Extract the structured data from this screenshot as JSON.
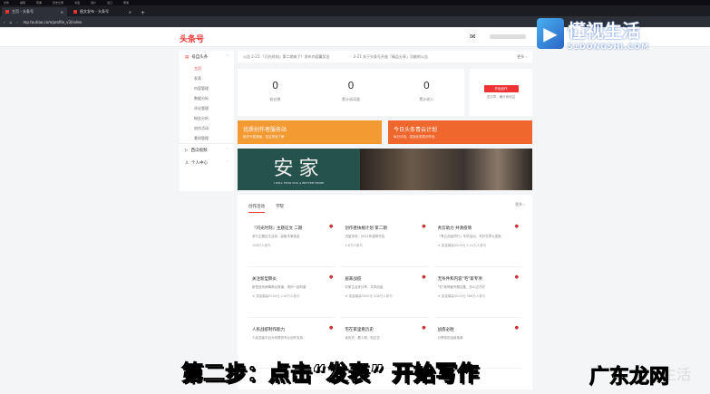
{
  "browser": {
    "menu": [
      "文件",
      "编辑",
      "查看",
      "历史记录",
      "书签",
      "用户",
      "窗口",
      "帮助"
    ],
    "tabs": [
      {
        "label": "主页 - 头条号"
      },
      {
        "label": "图文发布 - 头条号"
      }
    ],
    "url": "mp.toutiao.com/profile_v3/index"
  },
  "header": {
    "brand": "头条号",
    "mail_icon": "✉"
  },
  "sidebar": {
    "groups": [
      {
        "label": "号自头条",
        "items": [
          "主页",
          "发表",
          "内容管理",
          "数据分析",
          "评论管理",
          "粉丝分析",
          "创作活动",
          "素材管理"
        ]
      },
      {
        "label": "西瓜视频"
      },
      {
        "label": "个人中心"
      }
    ]
  },
  "notice": {
    "left": "公告  2-21  『闪光时刻』第二期来了！发布内容赢奖金",
    "right": "2-21  关于头条号开放「精品分享」功能的公告",
    "more": "更多 ›"
  },
  "stats": [
    {
      "value": "0",
      "label": "粉丝数"
    },
    {
      "value": "0",
      "label": "累计阅读量"
    },
    {
      "value": "0",
      "label": "累计收入"
    }
  ],
  "publish": {
    "button": "开始创作",
    "hint": "发文章，赚头条收益"
  },
  "banners": [
    {
      "title": "优质创作者服务站",
      "sub": "服务专属通道，权益快速了解",
      "color": "#f39a33"
    },
    {
      "title": "今日头条青云计划",
      "sub": "每日评选，奖励优质原创作品",
      "color": "#f0672e"
    }
  ],
  "hero": {
    "title": "安家",
    "subtitle": "I WILL FIND YOU A BETTER HOME"
  },
  "activities": {
    "tabs": [
      "创作活动",
      "学院"
    ],
    "more": "更多 ›",
    "cards": [
      {
        "title": "『闪光时刻』主题征文 二期",
        "desc": "参与主题征文活动，赢取丰厚奖金",
        "meta": "108万人参与"
      },
      {
        "title": "创作者扶植计划 第二期",
        "desc": "流量扶持，2021年重磅开启",
        "meta": "4.8万人参与"
      },
      {
        "title": "青云助力 共清疫情",
        "desc": "「青云战疫同行」专项活动，写好文章大奖励",
        "meta": "★ 奖金最高5000元  3.41万人参与"
      },
      {
        "title": "关注新型肺炎",
        "desc": "新型冠状病毒肺炎报道，请你一起科普",
        "meta": "★ 奖金最高5000元  118万人参与"
      },
      {
        "title": "居家战疫",
        "desc": "宅家生活来分享，共同战疫",
        "meta": "★ 奖金最高5000元  308万人参与"
      },
      {
        "title": "无条件和内容\"宅\"家专项",
        "desc": "\"宅\"家神兽专题征集，怎么过才好",
        "meta": "★ 奖金最高5000元  388万人参与"
      },
      {
        "title": "人民战疫制作能力",
        "desc": "人民战疫平台为你提供专业创作支持",
        "meta": ""
      },
      {
        "title": "宅在家里看历史",
        "desc": "读历史，看人物，知过去",
        "meta": ""
      },
      {
        "title": "战疫必胜",
        "desc": "分享你的战疫故事",
        "meta": ""
      }
    ]
  },
  "overlay": {
    "logo_cn": "懂视生活",
    "logo_en": "51DONGSHI.COM",
    "subtitle": "第二步：点击“发表” 开始写作",
    "watermark": "广东龙网",
    "watermark2": "生活"
  }
}
